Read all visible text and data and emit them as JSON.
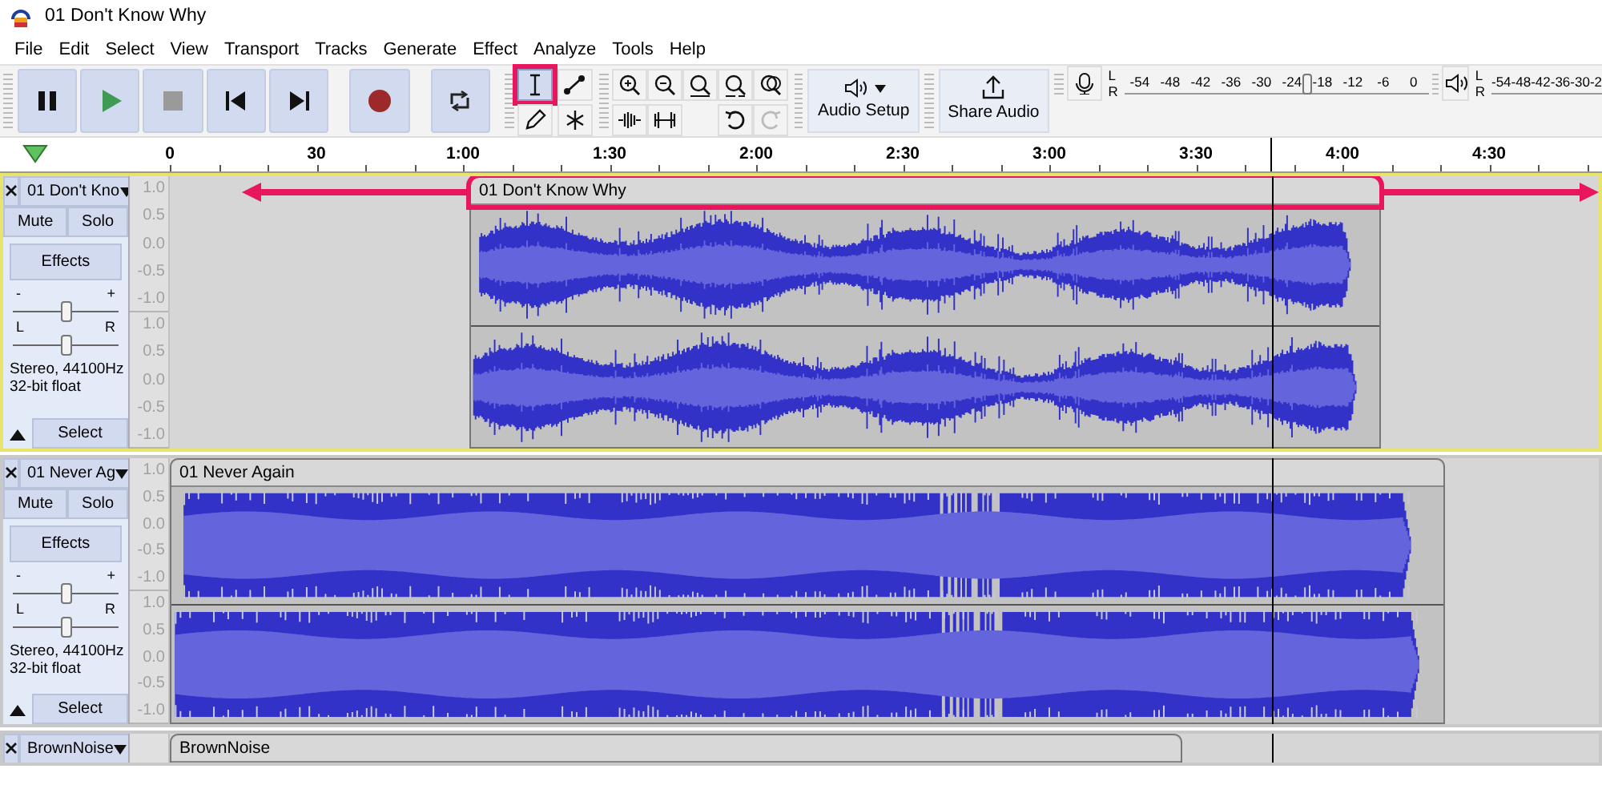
{
  "window": {
    "title": "01 Don't Know Why"
  },
  "menu": [
    "File",
    "Edit",
    "Select",
    "View",
    "Transport",
    "Tracks",
    "Generate",
    "Effect",
    "Analyze",
    "Tools",
    "Help"
  ],
  "transport": [
    {
      "kind": "pause"
    },
    {
      "kind": "play"
    },
    {
      "kind": "stop",
      "disabled": true
    },
    {
      "kind": "skip-start"
    },
    {
      "kind": "skip-end"
    },
    {
      "kind": "record"
    },
    {
      "kind": "loop"
    }
  ],
  "tools": [
    {
      "kind": "select",
      "selected": true,
      "highlighted": true
    },
    {
      "kind": "envelope",
      "selected": false,
      "highlighted": false
    },
    {
      "kind": "draw",
      "selected": false,
      "highlighted": false
    },
    {
      "kind": "multi",
      "selected": false,
      "highlighted": false
    }
  ],
  "edit_tools": [
    {
      "kind": "zoom-in"
    },
    {
      "kind": "zoom-out"
    },
    {
      "kind": "fit-selection"
    },
    {
      "kind": "fit-project"
    },
    {
      "kind": "zoom-toggle"
    },
    {
      "kind": "trim"
    },
    {
      "kind": "silence"
    },
    {
      "kind": "undo",
      "disabled": false
    },
    {
      "kind": "redo",
      "disabled": true
    }
  ],
  "audio_setup": {
    "label": "Audio Setup"
  },
  "share_audio": {
    "label": "Share Audio"
  },
  "record_meter": {
    "channels": [
      "L",
      "R"
    ],
    "ticks": [
      "-54",
      "-48",
      "-42",
      "-36",
      "-30",
      "-24",
      "-18",
      "-12",
      "-6",
      "0"
    ],
    "level": 0.6
  },
  "playback_meter": {
    "channels": [
      "L",
      "R"
    ],
    "ticks": [
      "-54",
      "-48",
      "-42",
      "-36",
      "-30",
      "-2"
    ]
  },
  "ruler": {
    "labels": [
      "0",
      "30",
      "1:00",
      "1:30",
      "2:00",
      "2:30",
      "3:00",
      "3:30",
      "4:00",
      "4:30"
    ]
  },
  "tracks": [
    {
      "name": "01 Don't Kno",
      "selected": true,
      "mute": "Mute",
      "solo": "Solo",
      "effects": "Effects",
      "gain": {
        "minus": "-",
        "plus": "+",
        "level": 0.5
      },
      "pan": {
        "left": "L",
        "right": "R",
        "level": 0.5
      },
      "format": [
        "Stereo, 44100Hz",
        "32-bit float"
      ],
      "select": "Select",
      "scale": [
        [
          "1.0",
          "0.5",
          "0.0",
          "-0.5",
          "-1.0"
        ],
        [
          "1.0",
          "0.5",
          "0.0",
          "-0.5",
          "-1.0"
        ]
      ],
      "clip": {
        "title": "01 Don't Know Why",
        "highlighted": true,
        "kind": "song"
      }
    },
    {
      "name": "01 Never Ag",
      "selected": false,
      "mute": "Mute",
      "solo": "Solo",
      "effects": "Effects",
      "gain": {
        "minus": "-",
        "plus": "+",
        "level": 0.5
      },
      "pan": {
        "left": "L",
        "right": "R",
        "level": 0.5
      },
      "format": [
        "Stereo, 44100Hz",
        "32-bit float"
      ],
      "select": "Select",
      "scale": [
        [
          "1.0",
          "0.5",
          "0.0",
          "-0.5",
          "-1.0"
        ],
        [
          "1.0",
          "0.5",
          "0.0",
          "-0.5",
          "-1.0"
        ]
      ],
      "clip": {
        "title": "01 Never Again",
        "highlighted": false,
        "kind": "loud"
      }
    },
    {
      "name": "BrownNoise",
      "selected": false,
      "clip": {
        "title": "BrownNoise",
        "highlighted": false
      }
    }
  ]
}
